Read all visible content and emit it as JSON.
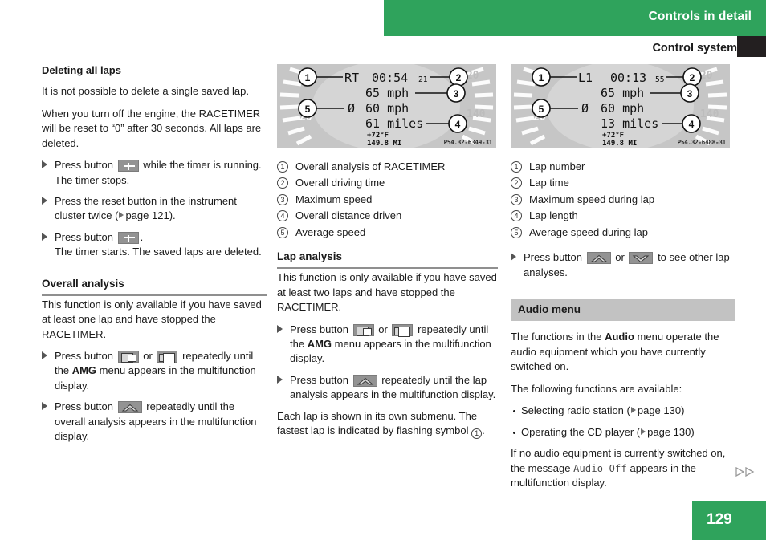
{
  "header": {
    "green_title": "Controls in detail",
    "sub_title": "Control system"
  },
  "footer": {
    "page_number": "129",
    "continuation_marks": "▷▷"
  },
  "colors": {
    "brand_green": "#2fa35c",
    "heading_box_gray": "#c2c2c2",
    "key_gray": "#939393",
    "tab_black": "#231f20"
  },
  "left_column": {
    "heading1": "Deleting all laps",
    "para1": "It is not possible to delete a single saved lap.",
    "para2": "When you turn off the engine, the RACETIMER will be reset to “0” after 30 seconds. All laps are deleted.",
    "step1_before": "Press button",
    "step1_after": "while the timer is running.",
    "step1_sub": "The timer stops.",
    "step2_before": "Press the reset button in the instrument cluster twice (",
    "step2_xref": "page 121).",
    "step3_before": "Press button",
    "step3_after": ".",
    "step3_sub": "The timer starts. The saved laps are deleted.",
    "heading2": "Overall analysis",
    "para3": "This function is only available if you have saved at least one lap and have stopped the RACETIMER.",
    "step4_before": "Press button",
    "step4_mid": "or",
    "step4_after_1": "repeatedly until the",
    "step4_bold": "AMG",
    "step4_after_2": "menu appears in the multifunction display.",
    "step5_before": "Press button",
    "step5_after": "repeatedly until the overall analysis appears in the multifunction display."
  },
  "middle_column": {
    "figure": {
      "line1_label": "RT",
      "line1_time": "00:54",
      "line1_small": "21",
      "line2": "65 mph",
      "line3_symbol": "Ø",
      "line3": "60 mph",
      "line4": "61 miles",
      "line5": "+72°F",
      "line6": "149.8 MI",
      "code": "P54.32-6349-31",
      "dial_left": "20",
      "dial_right_top": "120",
      "dial_right_mid": "140",
      "callouts": [
        "1",
        "2",
        "3",
        "4",
        "5"
      ]
    },
    "legend": [
      {
        "num": "1",
        "text": "Overall analysis of RACETIMER"
      },
      {
        "num": "2",
        "text": "Overall driving time"
      },
      {
        "num": "3",
        "text": "Maximum speed"
      },
      {
        "num": "4",
        "text": "Overall distance driven"
      },
      {
        "num": "5",
        "text": "Average speed"
      }
    ],
    "heading": "Lap analysis",
    "para1": "This function is only available if you have saved at least two laps and have stopped the RACETIMER.",
    "step1_before": "Press button",
    "step1_mid": "or",
    "step1_after_1": "repeatedly until",
    "step1_the": "the",
    "step1_bold": "AMG",
    "step1_after_2": "menu appears in the multifunction display.",
    "step2_before": "Press button",
    "step2_after": "repeatedly until the lap analysis appears in the multifunction display.",
    "para2_a": "Each lap is shown in its own submenu. The fastest lap is indicated by flashing symbol",
    "para2_circ": "1",
    "para2_b": "."
  },
  "right_column": {
    "figure": {
      "line1_label": "L1",
      "line1_time": "00:13",
      "line1_small": "55",
      "line2": "65 mph",
      "line3_symbol": "Ø",
      "line3": "60 mph",
      "line4": "13 miles",
      "line5": "+72°F",
      "line6": "149.8 MI",
      "code": "P54.32-6488-31",
      "dial_left": "20",
      "dial_right_top": "120",
      "dial_right_mid": "140",
      "callouts": [
        "1",
        "2",
        "3",
        "4",
        "5"
      ]
    },
    "legend": [
      {
        "num": "1",
        "text": "Lap number"
      },
      {
        "num": "2",
        "text": "Lap time"
      },
      {
        "num": "3",
        "text": "Maximum speed during lap"
      },
      {
        "num": "4",
        "text": "Lap length"
      },
      {
        "num": "5",
        "text": "Average speed during lap"
      }
    ],
    "step1_before": "Press button",
    "step1_mid": "or",
    "step1_after": "to see other lap analyses.",
    "heading": "Audio menu",
    "para1_a": "The functions in the",
    "para1_bold": "Audio",
    "para1_b": "menu operate the audio equipment which you have currently switched on.",
    "para2": "The following functions are available:",
    "bullet1_text": "Selecting radio station (",
    "bullet1_xref": "page 130)",
    "bullet2_text": "Operating the CD player (",
    "bullet2_xref": "page 130)",
    "para3_a": "If no audio equipment is currently switched on, the message",
    "para3_mono": "Audio Off",
    "para3_b": "appears in the multifunction display."
  },
  "icons": {
    "plus_key": "plus-button-icon",
    "menu_left_key": "menu-left-button-icon",
    "menu_right_key": "menu-right-button-icon",
    "up_key": "up-arrow-button-icon",
    "down_key": "down-arrow-button-icon"
  }
}
